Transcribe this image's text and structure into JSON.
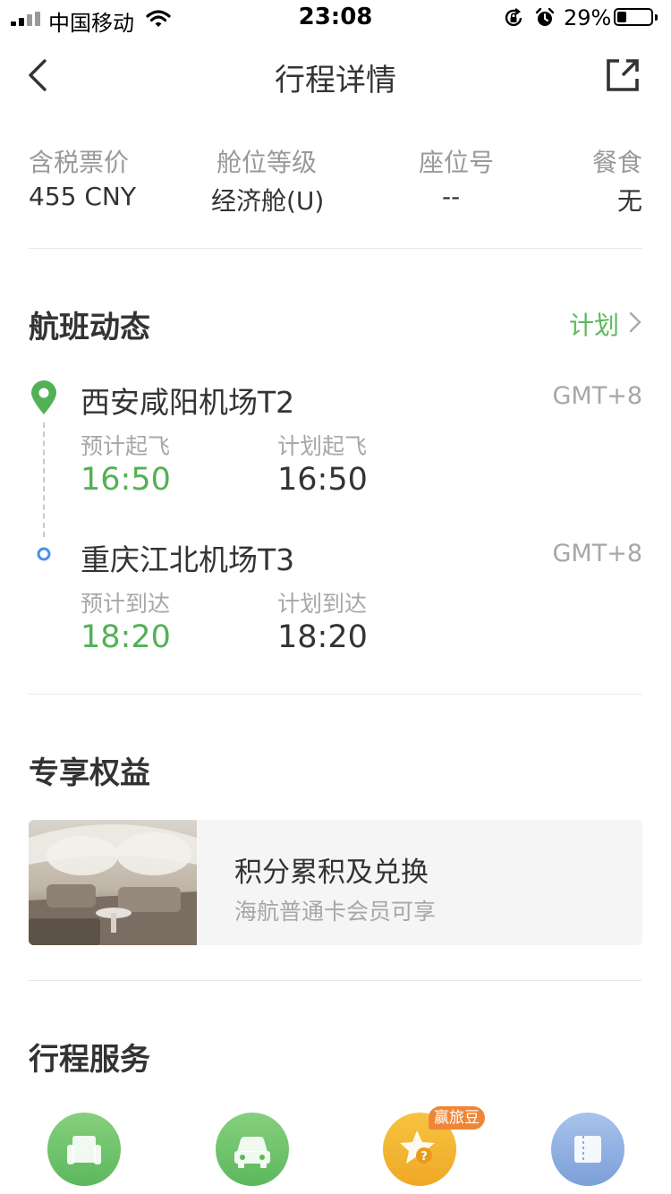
{
  "status_bar": {
    "carrier": "中国移动",
    "time": "23:08",
    "battery": "29%",
    "battery_level": 0.29
  },
  "nav": {
    "title": "行程详情",
    "back_icon": "chevron-left-icon",
    "share_icon": "share-external-icon"
  },
  "ticket": {
    "price_label": "含税票价",
    "price_value": "455 CNY",
    "cabin_label": "舱位等级",
    "cabin_value": "经济舱(U)",
    "seat_label": "座位号",
    "seat_value": "--",
    "meal_label": "餐食",
    "meal_value": "无"
  },
  "flight_status": {
    "title": "航班动态",
    "status_link": "计划",
    "departure": {
      "airport": "西安咸阳机场T2",
      "timezone": "GMT+8",
      "est_label": "预计起飞",
      "est_time": "16:50",
      "plan_label": "计划起飞",
      "plan_time": "16:50"
    },
    "arrival": {
      "airport": "重庆江北机场T3",
      "timezone": "GMT+8",
      "est_label": "预计到达",
      "est_time": "18:20",
      "plan_label": "计划到达",
      "plan_time": "18:20"
    }
  },
  "benefits": {
    "title": "专享权益",
    "card_title": "积分累积及兑换",
    "card_sub": "海航普通卡会员可享"
  },
  "services": {
    "title": "行程服务",
    "badge": "赢旅豆",
    "icons": [
      "seat-icon",
      "car-icon",
      "star-icon",
      "ticket-icon"
    ]
  },
  "colors": {
    "accent_green": "#52b155",
    "gray_text": "#a7a7a7",
    "badge_orange": "#ef8637"
  }
}
